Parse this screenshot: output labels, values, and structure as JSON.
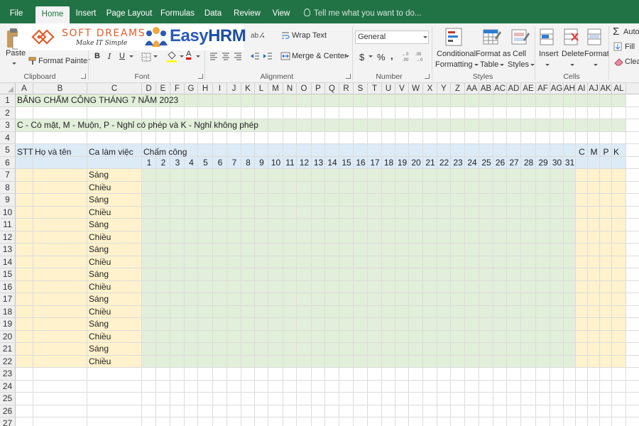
{
  "ribbon_tabs": [
    "File",
    "Home",
    "Insert",
    "Page Layout",
    "Formulas",
    "Data",
    "Review",
    "View"
  ],
  "active_tab": "Home",
  "tell_me": "Tell me what you want to do...",
  "clipboard": {
    "paste": "Paste",
    "format_painter": "Format Painter",
    "label": "Clipboard"
  },
  "font_group": {
    "bold": "B",
    "italic": "I",
    "underline": "U",
    "font_color_letter": "A",
    "label": "Font"
  },
  "alignment": {
    "wrap_text": "Wrap Text",
    "merge_center": "Merge & Center",
    "label": "Alignment"
  },
  "number": {
    "format": "General",
    "currency": "$",
    "percent": "%",
    "comma": ",",
    "label": "Number"
  },
  "styles": {
    "conditional": [
      "Conditional",
      "Formatting"
    ],
    "format_table": [
      "Format as",
      "Table"
    ],
    "cell_styles": [
      "Cell",
      "Styles"
    ],
    "label": "Styles"
  },
  "cells_group": {
    "insert": "Insert",
    "delete": "Delete",
    "format": "Format",
    "label": "Cells"
  },
  "editing": {
    "autosum": "Auto",
    "fill": "Fill",
    "clear": "Clear"
  },
  "logos": {
    "softdreams": {
      "name": "SOFT DREAMS",
      "tagline": "Make IT Simple"
    },
    "easyhrm": {
      "name_a": "Easy",
      "name_b": "HRM"
    }
  },
  "column_headers": [
    "A",
    "B",
    "C",
    "D",
    "E",
    "F",
    "G",
    "H",
    "I",
    "J",
    "K",
    "L",
    "M",
    "N",
    "O",
    "P",
    "Q",
    "R",
    "S",
    "T",
    "U",
    "V",
    "W",
    "X",
    "Y",
    "Z",
    "AA",
    "AB",
    "AC",
    "AD",
    "AE",
    "AF",
    "AG",
    "AH",
    "AI",
    "AJ",
    "AK",
    "AL"
  ],
  "row_numbers": [
    1,
    2,
    3,
    4,
    5,
    6,
    7,
    8,
    9,
    10,
    11,
    12,
    13,
    14,
    15,
    16,
    17,
    18,
    19,
    20,
    21,
    22,
    23,
    24,
    25,
    26,
    27
  ],
  "sheet": {
    "title": "BẢNG CHẤM CÔNG THÁNG 7 NĂM 2023",
    "legend": "C - Có mặt, M - Muộn, P - Nghỉ có phép và K - Nghỉ không phép",
    "hdr_stt": "STT",
    "hdr_name": "Họ và tên",
    "hdr_shift": "Ca làm việc",
    "hdr_attendance": "Chấm công",
    "summary_headers": [
      "C",
      "M",
      "P",
      "K"
    ],
    "days": [
      "1",
      "2",
      "3",
      "4",
      "5",
      "6",
      "7",
      "8",
      "9",
      "10",
      "11",
      "12",
      "13",
      "14",
      "15",
      "16",
      "17",
      "18",
      "19",
      "20",
      "21",
      "22",
      "23",
      "24",
      "25",
      "26",
      "27",
      "28",
      "29",
      "30",
      "31"
    ],
    "shifts": [
      "Sáng",
      "Chiều",
      "Sáng",
      "Chiều",
      "Sáng",
      "Chiều",
      "Sáng",
      "Chiều",
      "Sáng",
      "Chiều",
      "Sáng",
      "Chiều",
      "Sáng",
      "Chiều",
      "Sáng",
      "Chiều"
    ]
  },
  "colors": {
    "excel_green": "#217346",
    "title_band": "#e2efda",
    "header_band": "#ddebf7",
    "name_band": "#fff2cc",
    "attendance_band": "#e2efda"
  }
}
